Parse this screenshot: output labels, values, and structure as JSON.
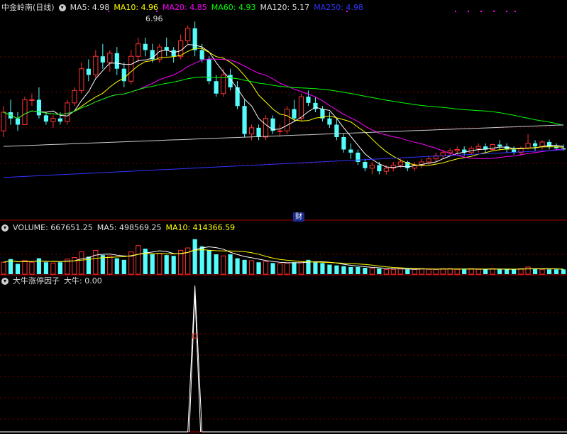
{
  "header": {
    "title": "中金岭南(日线)",
    "ma5": "MA5: 4.98",
    "ma10": "MA10: 4.96",
    "ma20": "MA20: 4.85",
    "ma60": "MA60: 4.93",
    "ma120": "MA120: 5.17",
    "ma250": "MA250: 4.98"
  },
  "volume_header": {
    "volume": "VOLUME: 667651.25",
    "ma5": "MA5: 498569.25",
    "ma10": "MA10: 414366.59"
  },
  "indicator_header": {
    "name": "大牛涨停因子",
    "value": "大牛: 0.00"
  },
  "annotations": {
    "peak_label": "6.96",
    "cai_badge": "财"
  },
  "colors": {
    "up": "#ff3232",
    "down": "#54fcfc",
    "ma5": "#ffffff",
    "ma10": "#ffff00",
    "ma20": "#ff00ff",
    "ma60": "#00ff00",
    "ma120": "#cccccc",
    "ma250": "#3333ff",
    "grid": "#7a0000",
    "ind": "#ffffff"
  },
  "chart_data": {
    "type": "candlestick",
    "price_range": [
      3.9,
      7.1
    ],
    "ohlc": [
      [
        5.2,
        5.6,
        5.1,
        5.5
      ],
      [
        5.5,
        5.7,
        5.3,
        5.4
      ],
      [
        5.4,
        5.5,
        5.2,
        5.3
      ],
      [
        5.3,
        5.75,
        5.3,
        5.7
      ],
      [
        5.7,
        5.8,
        5.6,
        5.7
      ],
      [
        5.7,
        5.9,
        5.4,
        5.45
      ],
      [
        5.45,
        5.5,
        5.3,
        5.35
      ],
      [
        5.35,
        5.45,
        5.25,
        5.4
      ],
      [
        5.4,
        5.5,
        5.3,
        5.35
      ],
      [
        5.35,
        5.7,
        5.3,
        5.65
      ],
      [
        5.65,
        5.9,
        5.6,
        5.85
      ],
      [
        5.85,
        6.3,
        5.8,
        6.2
      ],
      [
        6.2,
        6.35,
        6.0,
        6.1
      ],
      [
        6.1,
        6.5,
        6.05,
        6.4
      ],
      [
        6.4,
        6.6,
        6.2,
        6.3
      ],
      [
        6.3,
        6.5,
        6.15,
        6.45
      ],
      [
        6.45,
        6.55,
        6.1,
        6.2
      ],
      [
        6.2,
        6.3,
        5.9,
        6.0
      ],
      [
        6.0,
        6.5,
        5.95,
        6.4
      ],
      [
        6.4,
        6.7,
        6.3,
        6.6
      ],
      [
        6.6,
        6.7,
        6.4,
        6.5
      ],
      [
        6.5,
        6.6,
        6.3,
        6.35
      ],
      [
        6.35,
        6.6,
        6.3,
        6.55
      ],
      [
        6.55,
        6.7,
        6.4,
        6.5
      ],
      [
        6.5,
        6.55,
        6.3,
        6.4
      ],
      [
        6.4,
        6.75,
        6.35,
        6.65
      ],
      [
        6.65,
        6.9,
        6.6,
        6.85
      ],
      [
        6.85,
        6.96,
        6.4,
        6.5
      ],
      [
        6.5,
        6.6,
        6.3,
        6.35
      ],
      [
        6.35,
        6.4,
        5.95,
        6.0
      ],
      [
        6.0,
        6.1,
        5.75,
        5.8
      ],
      [
        5.8,
        6.2,
        5.75,
        6.1
      ],
      [
        6.1,
        6.2,
        5.85,
        5.9
      ],
      [
        5.9,
        6.0,
        5.55,
        5.6
      ],
      [
        5.6,
        5.7,
        5.1,
        5.15
      ],
      [
        5.15,
        5.3,
        5.05,
        5.25
      ],
      [
        5.25,
        5.3,
        5.05,
        5.1
      ],
      [
        5.1,
        5.45,
        5.05,
        5.4
      ],
      [
        5.4,
        5.45,
        5.15,
        5.2
      ],
      [
        5.2,
        5.3,
        5.1,
        5.2
      ],
      [
        5.2,
        5.6,
        5.15,
        5.55
      ],
      [
        5.55,
        5.7,
        5.35,
        5.4
      ],
      [
        5.4,
        5.8,
        5.35,
        5.75
      ],
      [
        5.75,
        5.85,
        5.6,
        5.65
      ],
      [
        5.65,
        5.75,
        5.5,
        5.55
      ],
      [
        5.55,
        5.6,
        5.35,
        5.4
      ],
      [
        5.4,
        5.5,
        5.25,
        5.3
      ],
      [
        5.3,
        5.4,
        5.05,
        5.1
      ],
      [
        5.1,
        5.15,
        4.85,
        4.9
      ],
      [
        4.9,
        5.0,
        4.75,
        4.85
      ],
      [
        4.85,
        4.9,
        4.65,
        4.7
      ],
      [
        4.7,
        4.75,
        4.55,
        4.6
      ],
      [
        4.6,
        4.7,
        4.5,
        4.65
      ],
      [
        4.65,
        4.7,
        4.5,
        4.55
      ],
      [
        4.55,
        4.65,
        4.5,
        4.6
      ],
      [
        4.6,
        4.7,
        4.55,
        4.65
      ],
      [
        4.65,
        4.75,
        4.6,
        4.7
      ],
      [
        4.7,
        4.72,
        4.55,
        4.6
      ],
      [
        4.6,
        4.7,
        4.55,
        4.65
      ],
      [
        4.65,
        4.75,
        4.6,
        4.7
      ],
      [
        4.7,
        4.8,
        4.65,
        4.75
      ],
      [
        4.75,
        4.85,
        4.7,
        4.8
      ],
      [
        4.8,
        4.9,
        4.75,
        4.85
      ],
      [
        4.85,
        4.92,
        4.8,
        4.88
      ],
      [
        4.88,
        4.95,
        4.82,
        4.9
      ],
      [
        4.9,
        4.95,
        4.8,
        4.85
      ],
      [
        4.85,
        4.95,
        4.82,
        4.92
      ],
      [
        4.92,
        5.0,
        4.85,
        4.95
      ],
      [
        4.95,
        5.0,
        4.85,
        4.9
      ],
      [
        4.9,
        5.0,
        4.88,
        4.98
      ],
      [
        4.98,
        5.05,
        4.9,
        4.95
      ],
      [
        4.95,
        5.0,
        4.85,
        4.9
      ],
      [
        4.9,
        4.95,
        4.82,
        4.85
      ],
      [
        4.85,
        4.95,
        4.8,
        4.92
      ],
      [
        4.92,
        5.15,
        4.9,
        5.0
      ],
      [
        5.0,
        5.05,
        4.88,
        4.95
      ],
      [
        4.95,
        5.05,
        4.9,
        5.02
      ],
      [
        5.02,
        5.06,
        4.9,
        4.95
      ],
      [
        4.95,
        5.0,
        4.9,
        4.92
      ],
      [
        4.92,
        4.98,
        4.88,
        4.9
      ]
    ],
    "volume": [
      30,
      38,
      26,
      34,
      30,
      40,
      30,
      28,
      30,
      38,
      42,
      56,
      44,
      60,
      48,
      46,
      40,
      36,
      56,
      72,
      64,
      50,
      52,
      48,
      46,
      60,
      66,
      88,
      70,
      60,
      50,
      46,
      50,
      40,
      36,
      34,
      30,
      32,
      28,
      26,
      28,
      30,
      32,
      36,
      30,
      28,
      24,
      22,
      20,
      18,
      18,
      16,
      14,
      14,
      12,
      12,
      14,
      12,
      12,
      14,
      12,
      12,
      14,
      14,
      12,
      12,
      14,
      12,
      12,
      14,
      12,
      12,
      12,
      14,
      18,
      14,
      12,
      12,
      12,
      12
    ],
    "volume_range": [
      0,
      100
    ],
    "indicator": {
      "peak_index": 27,
      "range": [
        0,
        1
      ]
    }
  }
}
